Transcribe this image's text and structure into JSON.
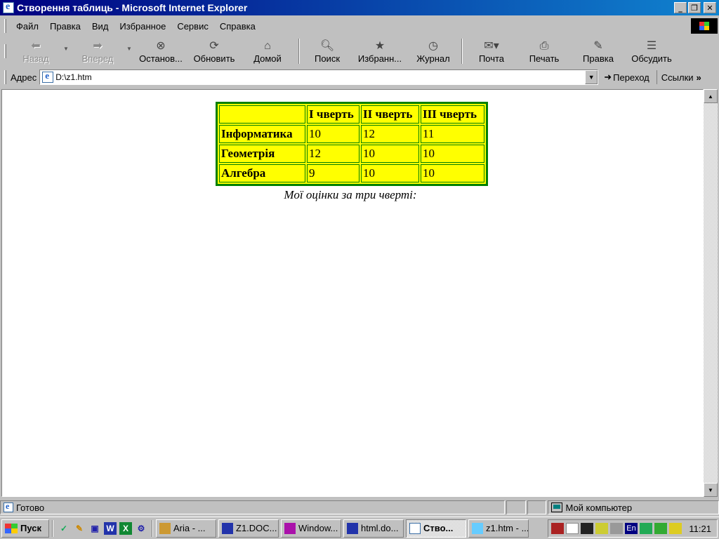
{
  "window": {
    "title": "Створення таблиць - Microsoft Internet Explorer",
    "minimize": "_",
    "restore": "❐",
    "close": "✕"
  },
  "menu": [
    {
      "label": "Файл"
    },
    {
      "label": "Правка"
    },
    {
      "label": "Вид"
    },
    {
      "label": "Избранное"
    },
    {
      "label": "Сервис"
    },
    {
      "label": "Справка"
    }
  ],
  "toolbar": {
    "back": "Назад",
    "forward": "Вперед",
    "stop": "Останов...",
    "refresh": "Обновить",
    "home": "Домой",
    "search": "Поиск",
    "favorites": "Избранн...",
    "history": "Журнал",
    "mail": "Почта",
    "print": "Печать",
    "edit": "Правка",
    "discuss": "Обсудить"
  },
  "address": {
    "label": "Адрес",
    "value": "D:\\z1.htm",
    "go": "Переход",
    "links": "Ссылки"
  },
  "page": {
    "table": {
      "headers": [
        "",
        "І чверть",
        "ІІ чверть",
        "ІІІ чверть"
      ],
      "rows": [
        [
          "Інформатика",
          "10",
          "12",
          "11"
        ],
        [
          "Геометрія",
          "12",
          "10",
          "10"
        ],
        [
          "Алгебра",
          "9",
          "10",
          "10"
        ]
      ],
      "colors": {
        "background": "#ffff00",
        "border": "#008000"
      }
    },
    "caption": "Мої оцінки за три чверті:"
  },
  "status": {
    "text": "Готово",
    "zone": "Мой компьютер"
  },
  "taskbar": {
    "start": "Пуск",
    "tasks": [
      {
        "label": "Aria - ...",
        "icon": "aria-icon",
        "active": false
      },
      {
        "label": "Z1.DOC...",
        "icon": "word-icon",
        "active": false
      },
      {
        "label": "Window...",
        "icon": "floppy-icon",
        "active": false
      },
      {
        "label": "html.do...",
        "icon": "word-icon",
        "active": false
      },
      {
        "label": "Ство...",
        "icon": "ie-icon",
        "active": true
      },
      {
        "label": "z1.htm - ...",
        "icon": "notepad-icon",
        "active": false
      }
    ],
    "lang": "En",
    "clock": "11:21"
  }
}
